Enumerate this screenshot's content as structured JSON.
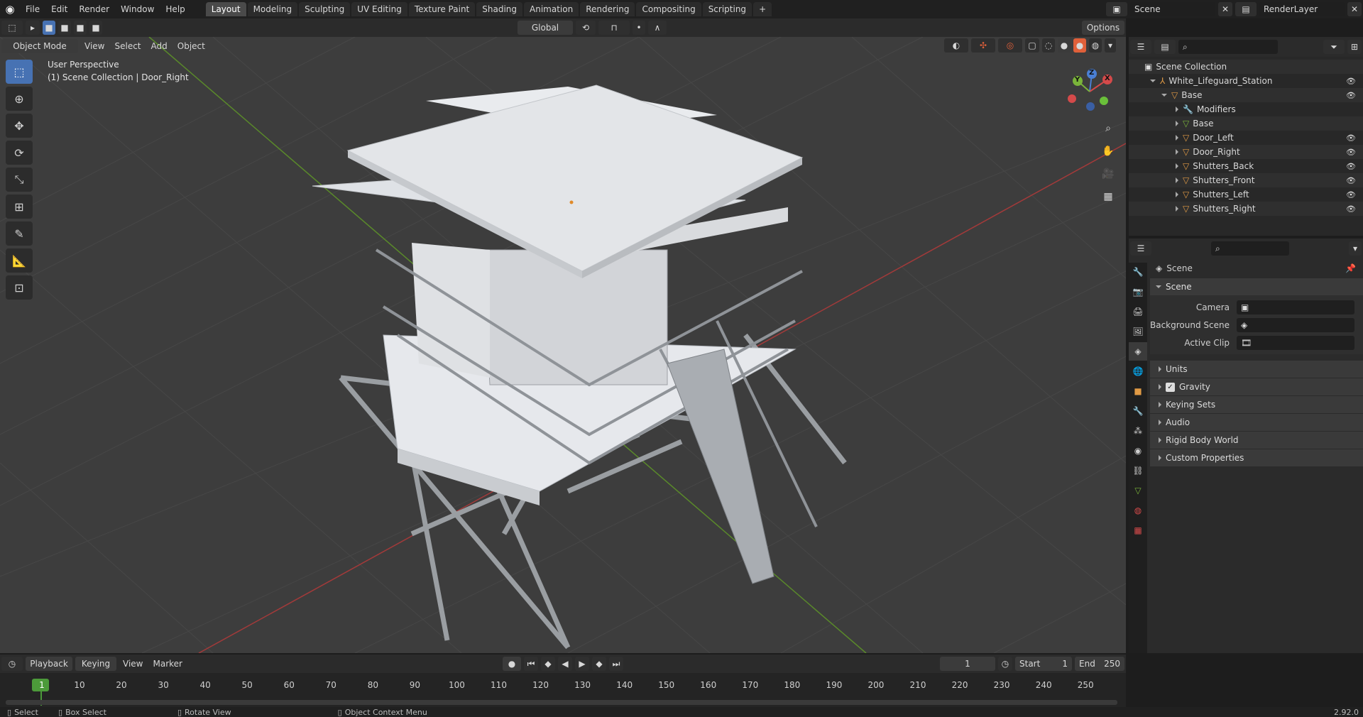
{
  "topbar": {
    "menus": [
      "File",
      "Edit",
      "Render",
      "Window",
      "Help"
    ],
    "workspaces": [
      "Layout",
      "Modeling",
      "Sculpting",
      "UV Editing",
      "Texture Paint",
      "Shading",
      "Animation",
      "Rendering",
      "Compositing",
      "Scripting"
    ],
    "active_workspace": "Layout",
    "add_tab": "+",
    "scene_name": "Scene",
    "view_layer": "RenderLayer"
  },
  "viewport_header": {
    "mode": "Object Mode",
    "menus": [
      "View",
      "Select",
      "Add",
      "Object"
    ],
    "orientation": "Global",
    "options": "Options"
  },
  "viewport": {
    "perspective_label": "User Perspective",
    "context_label": "(1) Scene Collection | Door_Right",
    "gizmo": {
      "x": "X",
      "y": "Y",
      "z": "Z"
    },
    "colors": {
      "x_axis": "#a33a3a",
      "y_axis": "#5a8a2a",
      "bg": "#3d3d3d"
    }
  },
  "outliner": {
    "root": "Scene Collection",
    "collection": "White_Lifeguard_Station",
    "parent": "Base",
    "children": [
      "Modifiers",
      "Base",
      "Door_Left",
      "Door_Right",
      "Shutters_Back",
      "Shutters_Front",
      "Shutters_Left",
      "Shutters_Right"
    ]
  },
  "properties": {
    "header": "Scene",
    "panel": "Scene",
    "rows": [
      {
        "label": "Camera",
        "value": ""
      },
      {
        "label": "Background Scene",
        "value": ""
      },
      {
        "label": "Active Clip",
        "value": ""
      }
    ],
    "subpanels": [
      "Units",
      "Gravity",
      "Keying Sets",
      "Audio",
      "Rigid Body World",
      "Custom Properties"
    ],
    "gravity_checked": true
  },
  "timeline": {
    "menus": [
      "Playback",
      "Keying",
      "View",
      "Marker"
    ],
    "current_frame": "1",
    "start_label": "Start",
    "start": "1",
    "end_label": "End",
    "end": "250",
    "ruler": [
      "1",
      "10",
      "20",
      "30",
      "40",
      "50",
      "60",
      "70",
      "80",
      "90",
      "100",
      "110",
      "120",
      "130",
      "140",
      "150",
      "160",
      "170",
      "180",
      "190",
      "200",
      "210",
      "220",
      "230",
      "240",
      "250"
    ]
  },
  "statusbar": {
    "select": "Select",
    "box_select": "Box Select",
    "rotate_view": "Rotate View",
    "context_menu": "Object Context Menu",
    "version": "2.92.0"
  }
}
